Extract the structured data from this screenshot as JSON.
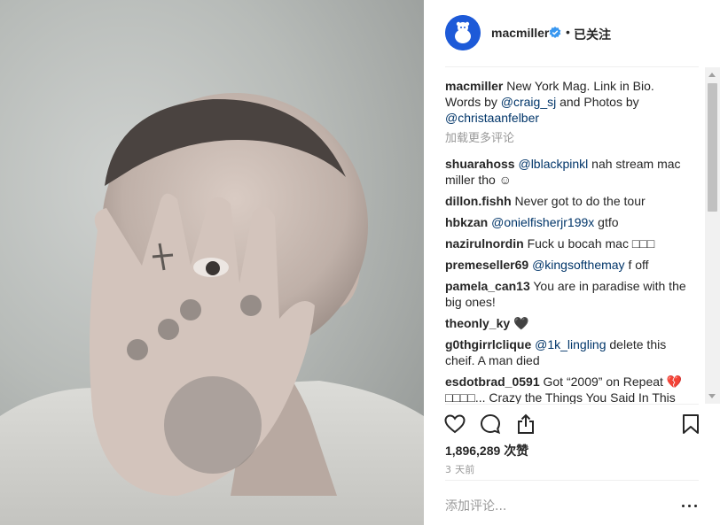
{
  "post": {
    "photo_alt": "portrait photo",
    "header": {
      "username": "macmiller",
      "verified_icon": "verified-badge-icon",
      "separator": "•",
      "follow_label": "已关注",
      "accent_color": "#3897f0",
      "avatar_bg": "#1d5ad8"
    },
    "caption": {
      "username": "macmiller",
      "text_1": " New York Mag. Link in Bio. Words by ",
      "mention_1": "@craig_sj",
      "text_2": " and Photos by ",
      "mention_2": "@christaanfelber"
    },
    "load_more_label": "加载更多评论",
    "comments": [
      {
        "user": "shuarahoss",
        "mention": "@lblackpinkl",
        "text": " nah stream mac miller tho ☺"
      },
      {
        "user": "dillon.fishh",
        "mention": "",
        "text": " Never got to do the tour"
      },
      {
        "user": "hbkzan",
        "mention": "@onielfisherjr199x",
        "text": " gtfo"
      },
      {
        "user": "nazirulnordin",
        "mention": "",
        "text": " Fuck u bocah mac □□□"
      },
      {
        "user": "premeseller69",
        "mention": "@kingsofthemay",
        "text": " f off"
      },
      {
        "user": "pamela_can13",
        "mention": "",
        "text": " You are in paradise with the big ones!"
      },
      {
        "user": "theonly_ky",
        "mention": "",
        "text": " 🖤"
      },
      {
        "user": "g0thgirrlclique",
        "mention": "@1k_lingling",
        "text": " delete this cheif. A man died"
      },
      {
        "user": "esdotbrad_0591",
        "mention": "",
        "text": " Got “2009” on Repeat 💔 □□□□... Crazy the Things You Said In This"
      }
    ],
    "actions": {
      "like_icon": "heart-icon",
      "comment_icon": "comment-icon",
      "share_icon": "share-icon",
      "save_icon": "bookmark-icon"
    },
    "likes": {
      "count": "1,896,289",
      "label": "次赞"
    },
    "time_ago": "3 天前",
    "add_comment": {
      "placeholder": "添加评论...",
      "value": ""
    },
    "more_icon": "more-options-icon"
  }
}
